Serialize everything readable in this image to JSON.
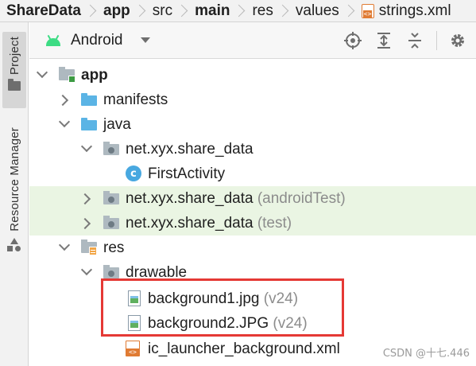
{
  "breadcrumb": {
    "items": [
      {
        "label": "ShareData",
        "bold": true
      },
      {
        "label": "app",
        "bold": true
      },
      {
        "label": "src",
        "bold": false
      },
      {
        "label": "main",
        "bold": true
      },
      {
        "label": "res",
        "bold": false
      },
      {
        "label": "values",
        "bold": false
      },
      {
        "label": "strings.xml",
        "bold": false,
        "icon": "xml-file-icon"
      }
    ]
  },
  "tool_strip": {
    "project_label": "Project",
    "resource_manager_label": "Resource Manager"
  },
  "panel": {
    "view_selector": "Android",
    "header_icons": [
      "locate-icon",
      "expand-all-icon",
      "collapse-all-icon",
      "settings-gear-icon"
    ]
  },
  "tree": [
    {
      "label": "app",
      "suffix": "",
      "expanded": true,
      "icon": "module-folder-icon",
      "bold": true
    },
    {
      "label": "manifests",
      "suffix": "",
      "expanded": false,
      "icon": "folder-blue-icon"
    },
    {
      "label": "java",
      "suffix": "",
      "expanded": true,
      "icon": "folder-blue-icon"
    },
    {
      "label": "net.xyx.share_data",
      "suffix": "",
      "expanded": true,
      "icon": "package-icon"
    },
    {
      "label": "FirstActivity",
      "suffix": "",
      "icon": "class-icon"
    },
    {
      "label": "net.xyx.share_data",
      "suffix": "(androidTest)",
      "expanded": false,
      "icon": "package-icon",
      "test": true
    },
    {
      "label": "net.xyx.share_data",
      "suffix": "(test)",
      "expanded": false,
      "icon": "package-icon",
      "test": true
    },
    {
      "label": "res",
      "suffix": "",
      "expanded": true,
      "icon": "resource-folder-icon"
    },
    {
      "label": "drawable",
      "suffix": "",
      "expanded": true,
      "icon": "package-icon"
    },
    {
      "label": "background1.jpg",
      "suffix": "(v24)",
      "icon": "image-file-icon"
    },
    {
      "label": "background2.JPG",
      "suffix": "(v24)",
      "icon": "image-file-icon"
    },
    {
      "label": "ic_launcher_background.xml",
      "suffix": "",
      "icon": "xml-file-icon"
    }
  ],
  "watermark": "CSDN @十七.446",
  "colors": {
    "highlight": "#e53935",
    "test_row_bg": "#eaf5e3",
    "folder_blue": "#5bb4e5",
    "android_green": "#3ddc84"
  }
}
